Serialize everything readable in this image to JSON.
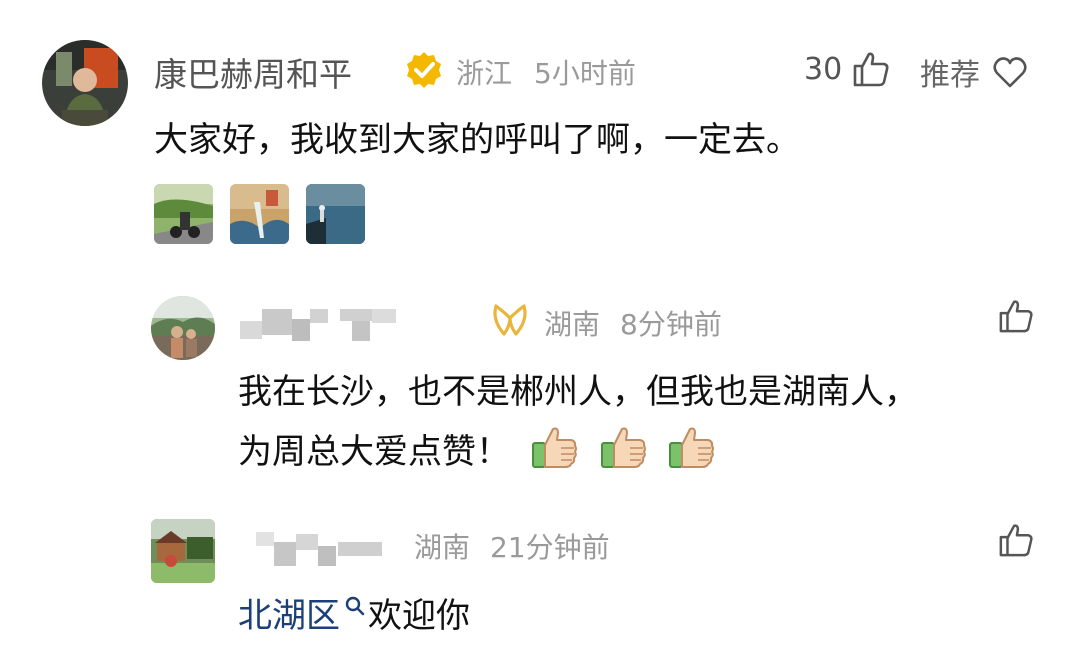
{
  "comment1": {
    "author": "康巴赫周和平",
    "location": "浙江",
    "time": "5小时前",
    "like_count": "30",
    "recommend_label": "推荐",
    "text": "大家好，我收到大家的呼叫了啊，一定去。"
  },
  "reply1": {
    "location": "湖南",
    "time": "8分钟前",
    "text_line1": "我在长沙，也不是郴州人，但我也是湖南人，",
    "text_line2": "为周总大爱点赞！"
  },
  "reply2": {
    "location": "湖南",
    "time": "21分钟前",
    "link_text": "北湖区",
    "text_after": "欢迎你"
  },
  "colors": {
    "verified_badge": "#f5b800",
    "membership_badge": "#e9b53d",
    "link": "#1c3f78",
    "meta_grey": "#9a9a9a"
  },
  "icons": {
    "verified": "verified-badge-icon",
    "like": "thumbs-up-outline-icon",
    "heart": "heart-outline-icon",
    "membership": "membership-badge-icon",
    "search": "search-icon",
    "emoji": "thumbs-up-emoji-icon"
  }
}
